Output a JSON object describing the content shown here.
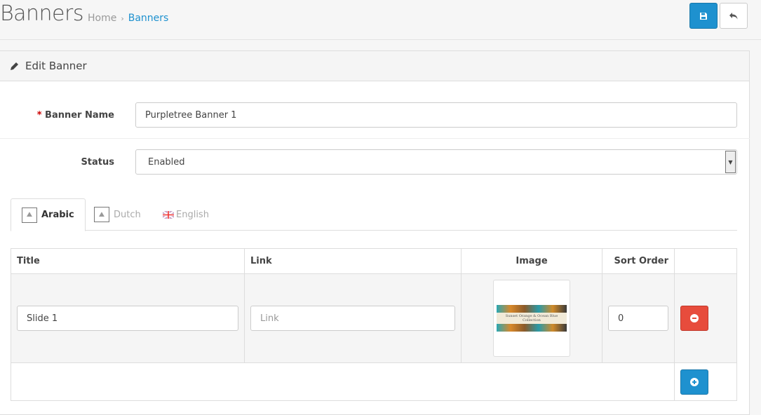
{
  "header": {
    "title": "Banners",
    "breadcrumb": [
      {
        "label": "Home"
      },
      {
        "label": "Banners"
      }
    ],
    "breadcrumb_sep": "›"
  },
  "panel": {
    "title": "Edit Banner"
  },
  "form": {
    "banner_name": {
      "label": "Banner Name",
      "required_mark": "*",
      "value": "Purpletree Banner 1"
    },
    "status": {
      "label": "Status",
      "value": "Enabled"
    }
  },
  "tabs": [
    {
      "label": "Arabic",
      "active": true
    },
    {
      "label": "Dutch"
    },
    {
      "label": "English"
    }
  ],
  "table": {
    "headers": [
      "Title",
      "Link",
      "Image",
      "Sort Order",
      ""
    ],
    "rows": [
      {
        "title": "Slide 1",
        "link_placeholder": "Link",
        "image_text": "Sunset Orange & Ocean Blue Collection",
        "sort_order": "0"
      }
    ]
  },
  "colors": {
    "primary": "#1e91cf",
    "danger": "#e74c3c"
  }
}
